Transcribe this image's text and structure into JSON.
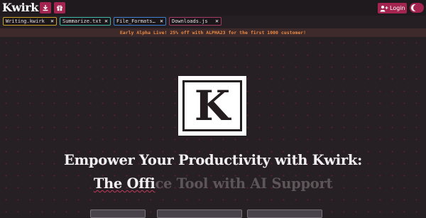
{
  "app": {
    "logo_text": "Kwirk"
  },
  "header": {
    "icons": [
      "download-icon",
      "gift-icon"
    ],
    "login_label": "Login",
    "login_icon": "add-user-icon",
    "theme_toggle_icon": "moon-icon"
  },
  "tabs": [
    {
      "label": "Writing.kwirk",
      "border_color": "#c9a227"
    },
    {
      "label": "Summarize.txt",
      "border_color": "#3fb8a8"
    },
    {
      "label": "File_Formats…",
      "border_color": "#3f7fcf"
    },
    {
      "label": "Downloads.js",
      "border_color": "#a33a66"
    }
  ],
  "tab_close_glyph": "✕",
  "banner": {
    "text": "Early Alpha Live! 25% off with ALPHA23 for the first 1000 customer!"
  },
  "hero": {
    "logo_letter": "K",
    "headline": "Empower Your Productivity with Kwirk:",
    "sub_typed": "The Offi",
    "sub_faded": "ce Tool with AI Support"
  },
  "colors": {
    "accent": "#a3244f",
    "background": "#251e22",
    "banner_text": "#ea8b46",
    "dot_pattern": "#5a2230"
  }
}
